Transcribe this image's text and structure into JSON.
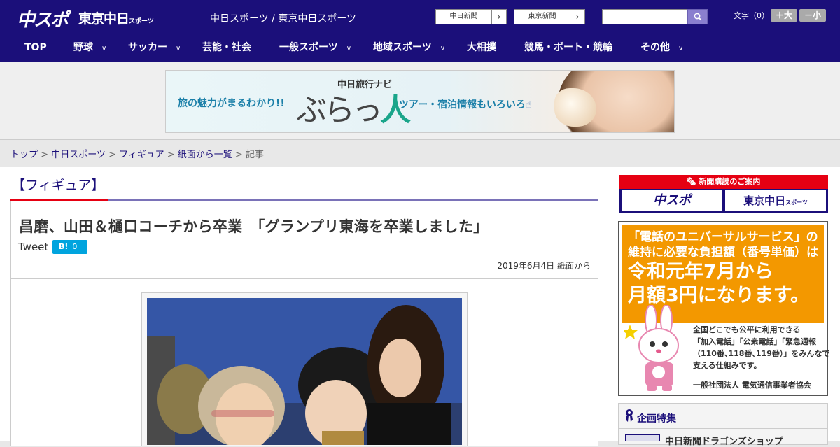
{
  "header": {
    "logo_main": "中スポ",
    "logo_tokyo": "東京中日",
    "logo_tokyo_small": "スポーツ",
    "site_title": "中日スポーツ / 東京中日スポーツ",
    "link1": "中日新聞",
    "link2": "東京新聞",
    "search_placeholder": "",
    "font_label": "文字（0）",
    "font_larger": "＋大",
    "font_smaller": "－小"
  },
  "nav": {
    "items": [
      {
        "label": "TOP"
      },
      {
        "label": "野球"
      },
      {
        "label": "サッカー"
      },
      {
        "label": "芸能・社会"
      },
      {
        "label": "一般スポーツ"
      },
      {
        "label": "地域スポーツ"
      },
      {
        "label": "大相撲"
      },
      {
        "label": "競馬・ボート・競輪"
      },
      {
        "label": "その他"
      }
    ]
  },
  "banner": {
    "catch": "旅の魅力がまるわかり!!",
    "subtitle": "中日旅行ナビ",
    "logo_a": "ぶらっ",
    "logo_b": "人",
    "tagline": "ツアー・宿泊情報もいろいろ"
  },
  "breadcrumb": {
    "items": [
      "トップ",
      "中日スポーツ",
      "フィギュア",
      "紙面から一覧"
    ],
    "current": "記事",
    "sep": " > "
  },
  "article": {
    "category": "【フィギュア】",
    "headline": "昌磨、山田＆樋口コーチから卒業　「グランプリ東海を卒業しました」",
    "tweet": "Tweet",
    "hatena_label": "B!",
    "hatena_count": "0",
    "date": "2019年6月4日 紙面から"
  },
  "sidebar": {
    "subscribe_title": "新聞購読のご案内",
    "subscribe_logo1": "中スポ",
    "subscribe_logo2": "東京中日",
    "subscribe_logo2_small": "スポーツ",
    "ad_question_1": "「電話のユニバーサルサービス」の",
    "ad_question_2": "維持に必要な負担額（番号単価）は",
    "ad_big_1": "令和元年7月から",
    "ad_big_2": "月額3円になります。",
    "ad_body_1": "全国どこでも公平に利用できる",
    "ad_body_2": "「加入電話」「公衆電話」「緊急通報",
    "ad_body_3": "（110番､118番､119番）」をみんなで",
    "ad_body_4": "支える仕組みです。",
    "ad_org": "一般社団法人 電気通信事業者協会",
    "feature_title": "企画特集",
    "feature_item": "中日新聞ドラゴンズショップ"
  },
  "colors": {
    "brand_navy": "#1b0f7a",
    "accent_red": "#e60012",
    "ad_orange": "#f39800",
    "hatena_blue": "#00a4de"
  }
}
